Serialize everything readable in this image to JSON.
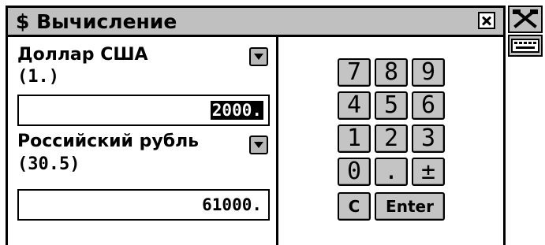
{
  "window": {
    "title": "$ Вычисление"
  },
  "converter": {
    "from": {
      "currency": "Доллар США",
      "rate": "(1.)",
      "value": "2000."
    },
    "to": {
      "currency": "Российский рубль",
      "rate": "(30.5)",
      "value": "61000."
    }
  },
  "keypad": {
    "keys": [
      "7",
      "8",
      "9",
      "4",
      "5",
      "6",
      "1",
      "2",
      "3",
      "0",
      ".",
      "±",
      "C",
      "Enter"
    ]
  },
  "sidebar": {
    "icons": [
      "tools-icon",
      "keyboard-icon"
    ]
  }
}
